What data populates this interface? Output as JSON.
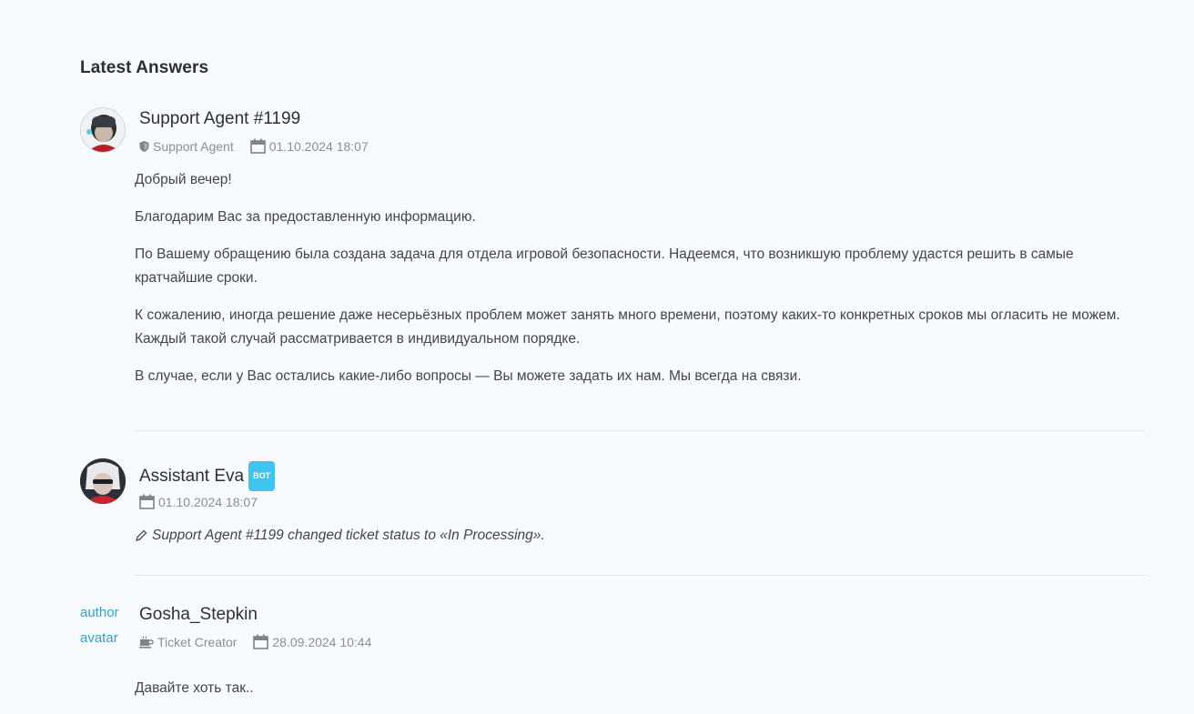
{
  "section": {
    "title": "Latest Answers"
  },
  "answers": [
    {
      "author": "Support Agent #1199",
      "role": "Support Agent",
      "date": "01.10.2024 18:07",
      "paragraphs": [
        "Добрый вечер!",
        "Благодарим Вас за предоставленную информацию.",
        "По Вашему обращению была создана задача для отдела игровой безопасности. Надеемся, что возникшую проблему удастся решить в самые кратчайшие сроки.",
        "К сожалению, иногда решение даже несерьёзных проблем может занять много времени, поэтому каких-то конкретных сроков мы огласить не можем. Каждый такой случай рассматривается в индивидуальном порядке.",
        "В случае, если у Вас остались какие-либо вопросы — Вы можете задать их нам. Мы всегда на связи."
      ]
    },
    {
      "author": "Assistant Eva",
      "badge": "BOT",
      "date": "01.10.2024 18:07",
      "status_text": "Support Agent #1199 changed ticket status to «In Processing»."
    },
    {
      "author": "Gosha_Stepkin",
      "role": "Ticket Creator",
      "date": "28.09.2024 10:44",
      "avatar_alt": "author avatar",
      "paragraphs": [
        "Давайте хоть так.."
      ]
    }
  ],
  "colors": {
    "accent": "#3fc5f0",
    "background": "#f7fbfd",
    "muted": "#8a8f95"
  }
}
